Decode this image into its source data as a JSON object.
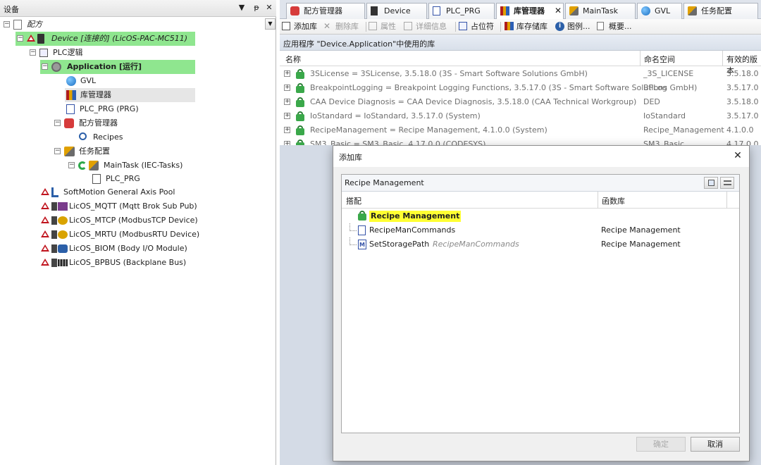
{
  "left_pane": {
    "title": "设备",
    "buttons": [
      "▼",
      "ᵽ",
      "✕"
    ],
    "tree": [
      {
        "label": "配方",
        "italic": true
      },
      {
        "label": "Device [连接的] (LicOS-PAC-MC511)"
      },
      {
        "label": "PLC逻辑"
      },
      {
        "label": "Application [运行]"
      },
      {
        "label": "GVL"
      },
      {
        "label": "库管理器"
      },
      {
        "label": "PLC_PRG (PRG)"
      },
      {
        "label": "配方管理器"
      },
      {
        "label": "Recipes"
      },
      {
        "label": "任务配置"
      },
      {
        "label": "MainTask (IEC-Tasks)"
      },
      {
        "label": "PLC_PRG"
      },
      {
        "label": "SoftMotion General Axis Pool"
      },
      {
        "label": "LicOS_MQTT (Mqtt Brok Sub Pub)"
      },
      {
        "label": "LicOS_MTCP (ModbusTCP Device)"
      },
      {
        "label": "LicOS_MRTU (ModbusRTU Device)"
      },
      {
        "label": "LicOS_BIOM (Body I/O Module)"
      },
      {
        "label": "LicOS_BPBUS (Backplane Bus)"
      }
    ]
  },
  "tabs": [
    {
      "label": "配方管理器"
    },
    {
      "label": "Device"
    },
    {
      "label": "PLC_PRG"
    },
    {
      "label": "库管理器",
      "active": true
    },
    {
      "label": "MainTask"
    },
    {
      "label": "GVL"
    },
    {
      "label": "任务配置"
    }
  ],
  "tab_close": "✕",
  "toolbar": {
    "items": [
      {
        "label": "添加库"
      },
      {
        "label": "删除库",
        "disabled": true
      },
      {
        "label": "属性",
        "disabled": true
      },
      {
        "label": "详细信息",
        "disabled": true
      },
      {
        "label": "占位符"
      },
      {
        "label": "库存储库"
      },
      {
        "label": "图例..."
      },
      {
        "label": "概要..."
      }
    ]
  },
  "library_panel": {
    "title": "应用程序 \"Device.Application\"中使用的库",
    "columns": [
      "名称",
      "命名空间",
      "有效的版本"
    ],
    "rows": [
      {
        "name": "3SLicense = 3SLicense, 3.5.18.0 (3S - Smart Software Solutions GmbH)",
        "namespace": "_3S_LICENSE",
        "version": "3.5.18.0"
      },
      {
        "name": "BreakpointLogging = Breakpoint Logging Functions, 3.5.17.0 (3S - Smart Software Solutions GmbH)",
        "namespace": "BPLog",
        "version": "3.5.17.0"
      },
      {
        "name": "CAA Device Diagnosis = CAA Device Diagnosis, 3.5.18.0 (CAA Technical Workgroup)",
        "namespace": "DED",
        "version": "3.5.18.0"
      },
      {
        "name": "IoStandard = IoStandard, 3.5.17.0 (System)",
        "namespace": "IoStandard",
        "version": "3.5.17.0"
      },
      {
        "name": "RecipeManagement = Recipe Management, 4.1.0.0 (System)",
        "namespace": "Recipe_Management",
        "version": "4.1.0.0"
      },
      {
        "name": "SM3_Basic = SM3_Basic, 4.17.0.0 (CODESYS)",
        "namespace": "SM3_Basic",
        "version": "4.17.0.0"
      }
    ]
  },
  "dialog": {
    "title": "添加库",
    "close": "✕",
    "search_value": "Recipe Management",
    "columns": [
      "搭配",
      "函数库"
    ],
    "rows": [
      {
        "match": "Recipe Management",
        "match_sub": "",
        "library": "",
        "highlight": true
      },
      {
        "match": "RecipeManCommands",
        "match_sub": "",
        "library": "Recipe Management"
      },
      {
        "match": "SetStoragePath",
        "match_sub": "RecipeManCommands",
        "library": "Recipe Management"
      }
    ],
    "ok_label": "确定",
    "cancel_label": "取消"
  },
  "colors": {
    "highlight_green": "#8fe68f",
    "highlight_yellow": "#ffff33",
    "error_red": "#c0141e",
    "lock_green": "#3aa84a"
  }
}
